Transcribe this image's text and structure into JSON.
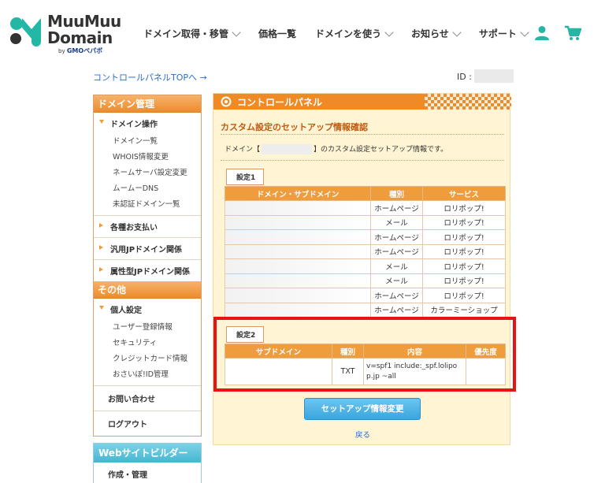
{
  "header": {
    "logo_line1": "MuuMuu",
    "logo_line2": "Domain",
    "logo_by": "by",
    "logo_brand": "GMOペパボ",
    "nav": [
      {
        "label": "ドメイン取得・移管",
        "has_dropdown": true
      },
      {
        "label": "価格一覧",
        "has_dropdown": false
      },
      {
        "label": "ドメインを使う",
        "has_dropdown": true
      },
      {
        "label": "お知らせ",
        "has_dropdown": true
      },
      {
        "label": "サポート",
        "has_dropdown": true
      }
    ],
    "brand_color": "#25b7a6"
  },
  "top": {
    "cp_top_link": "コントロールパネルTOPへ →",
    "id_label": "ID :"
  },
  "sidebar": {
    "domain_head": "ドメイン管理",
    "domain_ops": "ドメイン操作",
    "domain_items": [
      "ドメイン一覧",
      "WHOIS情報変更",
      "ネームサーバ設定変更",
      "ムームーDNS",
      "未認証ドメイン一覧"
    ],
    "payments": "各種お支払い",
    "generic_jp": "汎用JPドメイン関係",
    "attr_jp": "属性型JPドメイン関係",
    "other_head": "その他",
    "personal": "個人設定",
    "personal_items": [
      "ユーザー登録情報",
      "セキュリティ",
      "クレジットカード情報",
      "おさいぽ!ID管理"
    ],
    "contact": "お問い合わせ",
    "logout": "ログアウト",
    "web_head": "Webサイトビルダー",
    "web_item": "作成・管理"
  },
  "main": {
    "bar_title": "コントロールパネル",
    "section_title": "カスタム設定のセットアップ情報確認",
    "desc_prefix": "ドメイン【",
    "desc_suffix": "】のカスタム設定セットアップ情報です。",
    "set1_label": "設定1",
    "set1_headers": [
      "ドメイン・サブドメイン",
      "種別",
      "サービス"
    ],
    "set1_rows": [
      {
        "type": "ホームページ",
        "service": "ロリポップ!"
      },
      {
        "type": "メール",
        "service": "ロリポップ!"
      },
      {
        "type": "ホームページ",
        "service": "ロリポップ!"
      },
      {
        "type": "ホームページ",
        "service": "ロリポップ!"
      },
      {
        "type": "メール",
        "service": "ロリポップ!"
      },
      {
        "type": "メール",
        "service": "ロリポップ!"
      },
      {
        "type": "ホームページ",
        "service": "ロリポップ!"
      },
      {
        "type": "ホームページ",
        "service": "カラーミーショップ"
      }
    ],
    "set2_label": "設定2",
    "set2_headers": [
      "サブドメイン",
      "種別",
      "内容",
      "優先度"
    ],
    "set2_row": {
      "type": "TXT",
      "content_line1": "v=spf1 include:_spf.lolipo",
      "content_line2": "p.jp ~all",
      "priority": ""
    },
    "setup_button": "セットアップ情報変更",
    "back_link": "戻る"
  }
}
